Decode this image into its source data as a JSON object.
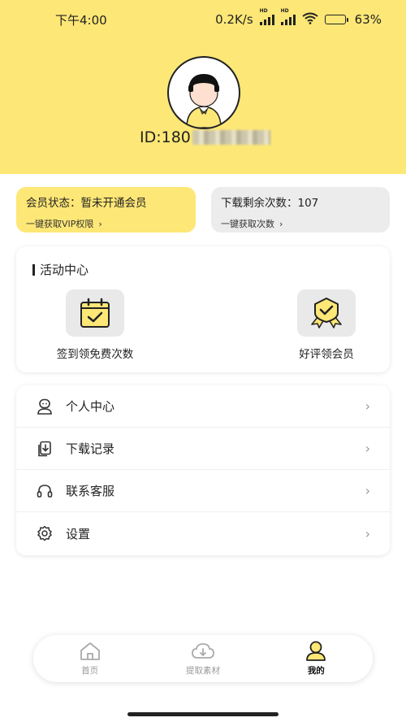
{
  "status_bar": {
    "time": "下午4:00",
    "network_speed": "0.2K/s",
    "network_badges": [
      "HD",
      "HD"
    ],
    "battery": "63%",
    "battery_level": 0.63
  },
  "profile": {
    "id_prefix": "ID:180"
  },
  "vip_card": {
    "status": "会员状态：暂未开通会员",
    "action": "一键获取VIP权限"
  },
  "download_card": {
    "remaining": "下载剩余次数：107",
    "action": "一键获取次数"
  },
  "activity": {
    "title": "活动中心",
    "items": [
      {
        "label": "签到领免费次数",
        "icon": "calendar-check-icon"
      },
      {
        "label": "好评领会员",
        "icon": "badge-check-icon"
      }
    ]
  },
  "menu": {
    "items": [
      {
        "label": "个人中心",
        "icon": "user-card-icon"
      },
      {
        "label": "下载记录",
        "icon": "download-record-icon"
      },
      {
        "label": "联系客服",
        "icon": "headset-icon"
      },
      {
        "label": "设置",
        "icon": "gear-icon"
      }
    ]
  },
  "tabbar": {
    "tabs": [
      {
        "label": "首页",
        "icon": "home-icon",
        "active": false
      },
      {
        "label": "提取素材",
        "icon": "cloud-download-icon",
        "active": false
      },
      {
        "label": "我的",
        "icon": "user-icon",
        "active": true
      }
    ]
  },
  "colors": {
    "accent_yellow": "#fde776",
    "card_gray": "#ececec"
  }
}
